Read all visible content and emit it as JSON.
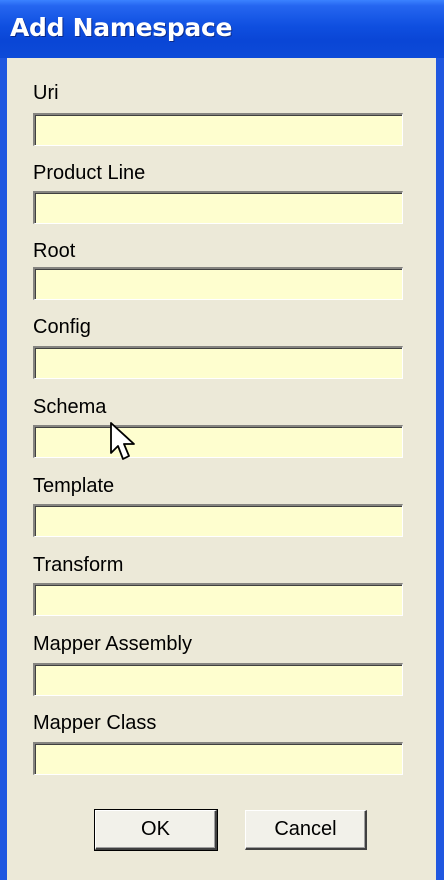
{
  "window": {
    "title": "Add Namespace"
  },
  "fields": [
    {
      "label": "Uri",
      "value": ""
    },
    {
      "label": "Product Line",
      "value": ""
    },
    {
      "label": "Root",
      "value": ""
    },
    {
      "label": "Config",
      "value": ""
    },
    {
      "label": "Schema",
      "value": ""
    },
    {
      "label": "Template",
      "value": ""
    },
    {
      "label": "Transform",
      "value": ""
    },
    {
      "label": "Mapper Assembly",
      "value": ""
    },
    {
      "label": "Mapper Class",
      "value": ""
    }
  ],
  "buttons": {
    "ok_label": "OK",
    "cancel_label": "Cancel"
  },
  "colors": {
    "titlebar": "#0a46d6",
    "client": "#ece9d8",
    "input_bg": "#fefecf"
  },
  "icons": {
    "cursor": "arrow-cursor-icon"
  }
}
